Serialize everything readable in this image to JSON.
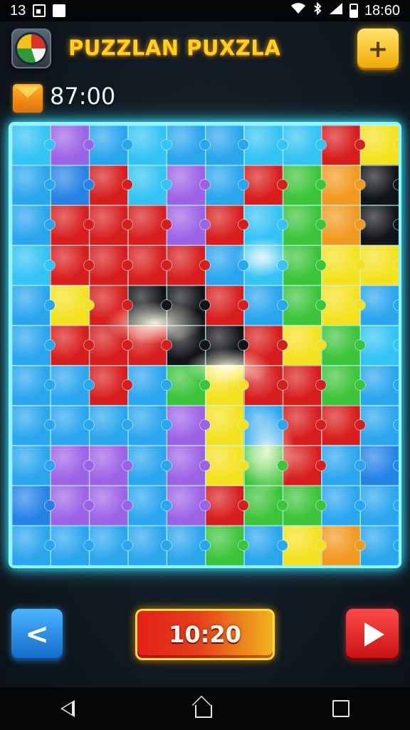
{
  "status_bar": {
    "left_text": "13",
    "time": "18:60",
    "left_icons": [
      "notification-square-icon",
      "gallery-icon"
    ],
    "right_icons": [
      "wifi-icon",
      "bluetooth-icon",
      "signal-icon",
      "battery-icon"
    ]
  },
  "header": {
    "title": "PUZZLAN PUXZLA",
    "logo_icon": "globe-badge-icon",
    "add_icon": "plus-icon",
    "add_symbol": "+"
  },
  "stats": {
    "mail_icon": "envelope-icon",
    "counter": "87:00"
  },
  "board": {
    "columns": 10,
    "rows": 11,
    "border_color": "#8ff6ff",
    "tile_colors": [
      "c p b c b b c c r y",
      "b n r c p b r g o k",
      "b r r r p r c g o k",
      "c r r r r b c g y y",
      "b y r k k r b g y b",
      "b r r r k k r y g c",
      "b b r b g y r r g b",
      "b b b b p y b r r b",
      "b p p b p y g r b n",
      "n p p b p r g g b b",
      "b b b b b g b y o b"
    ]
  },
  "controls": {
    "share_icon": "share-icon",
    "share_symbol": "<",
    "timer": "10:20",
    "play_icon": "play-icon"
  },
  "nav": {
    "icons": [
      "back-icon",
      "home-icon",
      "recents-icon"
    ]
  },
  "colors": {
    "title": "#ffd21c",
    "board_glow": "#36e4ff",
    "timer_red": "#e51f1a",
    "timer_yellow": "#f0b31c",
    "play_red": "#d81d1d",
    "share_blue": "#1e8ae0"
  }
}
